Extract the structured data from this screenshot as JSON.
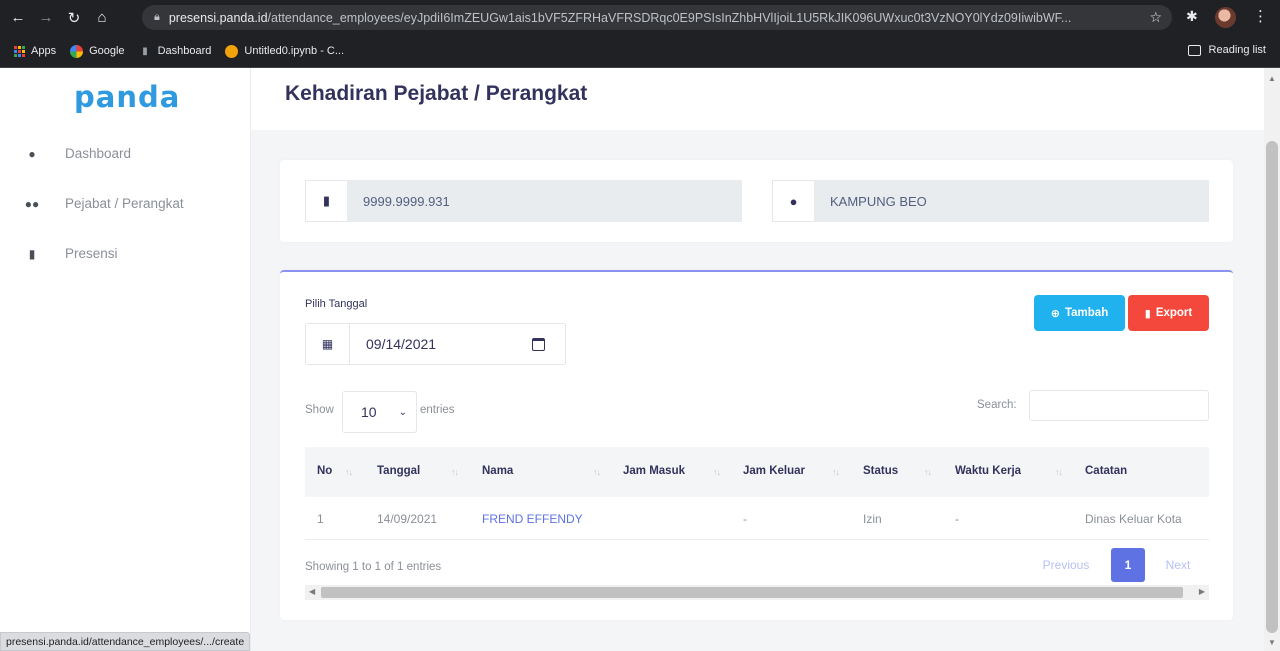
{
  "browser": {
    "url_host": "presensi.panda.id",
    "url_path": "/attendance_employees/eyJpdiI6ImZEUGw1ais1bVF5ZFRHaVFRSDRqc0E9PSIsInZhbHVlIjoiL1U5RkJIK096UWxuc0t3VzNOY0lYdz09IiwibWF...",
    "bookmarks": [
      {
        "label": "Apps",
        "icon": "apps-grid-icon"
      },
      {
        "label": "Google",
        "icon": "google-icon"
      },
      {
        "label": "Dashboard",
        "icon": "folder-icon"
      },
      {
        "label": "Untitled0.ipynb - C...",
        "icon": "jupyter-icon"
      }
    ],
    "reading_list": "Reading list",
    "status_url": "presensi.panda.id/attendance_employees/.../create"
  },
  "sidebar": {
    "logo": "panda",
    "items": [
      {
        "label": "Dashboard",
        "icon": "droplet-icon"
      },
      {
        "label": "Pejabat / Perangkat",
        "icon": "users-icon"
      },
      {
        "label": "Presensi",
        "icon": "clipboard-icon"
      }
    ]
  },
  "header": {
    "title": "Kehadiran Pejabat / Perangkat"
  },
  "info": {
    "id_number": "9999.9999.931",
    "location": "KAMPUNG BEO"
  },
  "filter": {
    "date_label": "Pilih Tanggal",
    "date_value": "09/14/2021",
    "add_button": "Tambah",
    "export_button": "Export"
  },
  "table_controls": {
    "show_label": "Show",
    "page_length": "10",
    "entries_label": "entries",
    "search_label": "Search:"
  },
  "table": {
    "columns": [
      "No",
      "Tanggal",
      "Nama",
      "Jam Masuk",
      "Jam Keluar",
      "Status",
      "Waktu Kerja",
      "Catatan"
    ],
    "rows": [
      {
        "no": "1",
        "tanggal": "14/09/2021",
        "nama": "FREND EFFENDY",
        "jam_masuk": "",
        "jam_keluar": "-",
        "status": "Izin",
        "waktu_kerja": "-",
        "catatan": "Dinas Keluar Kota"
      }
    ]
  },
  "pagination": {
    "info": "Showing 1 to 1 of 1 entries",
    "previous": "Previous",
    "current": "1",
    "next": "Next"
  },
  "colors": {
    "primary": "#5e72e4",
    "add_button": "#1fb2ee",
    "export_button": "#f5483d",
    "card_accent": "#8a93ef"
  }
}
